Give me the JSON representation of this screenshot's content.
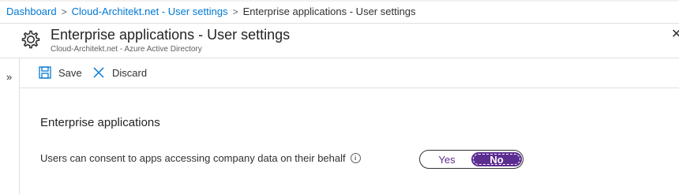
{
  "breadcrumb": {
    "items": [
      "Dashboard",
      "Cloud-Architekt.net - User settings"
    ],
    "current": "Enterprise applications - User settings"
  },
  "header": {
    "title": "Enterprise applications - User settings",
    "subtitle": "Cloud-Architekt.net - Azure Active Directory",
    "icon": "gear-icon"
  },
  "toolbar": {
    "save_label": "Save",
    "discard_label": "Discard"
  },
  "section": {
    "title": "Enterprise applications",
    "setting_label": "Users can consent to apps accessing company data on their behalf",
    "toggle": {
      "yes_label": "Yes",
      "no_label": "No",
      "selected": "No"
    }
  },
  "colors": {
    "link": "#0078d4",
    "toggle_accent": "#5c2d91"
  }
}
